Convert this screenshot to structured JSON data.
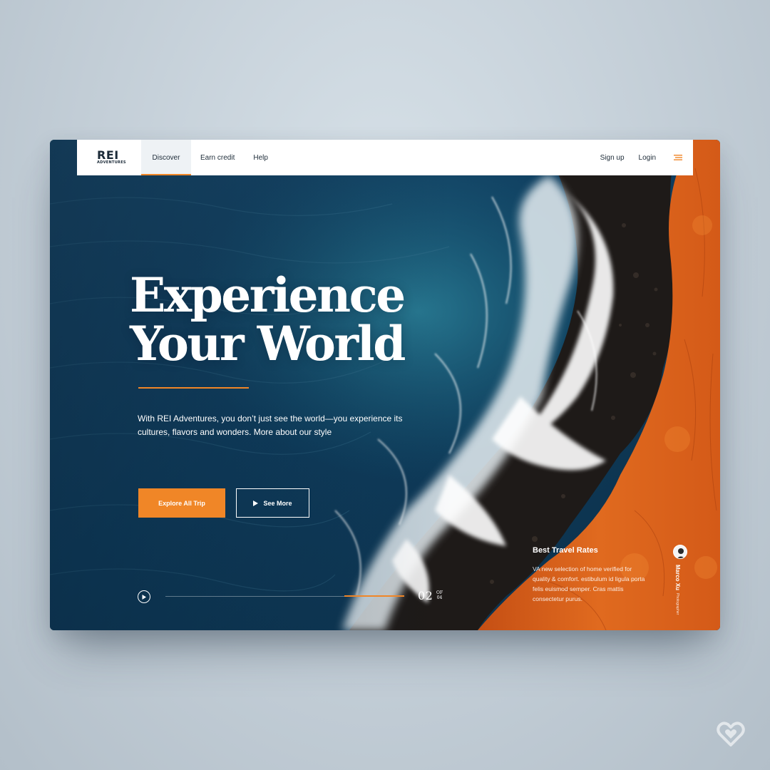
{
  "brand": {
    "name": "REI",
    "sub": "ADVENTURES"
  },
  "nav": {
    "tabs": [
      {
        "label": "Discover",
        "active": true
      },
      {
        "label": "Earn credit",
        "active": false
      },
      {
        "label": "Help",
        "active": false
      }
    ],
    "signup": "Sign up",
    "login": "Login",
    "menu_icon": "menu-icon"
  },
  "hero": {
    "title_line1": "Experience",
    "title_line2": "Your World",
    "description": "With REI Adventures, you don’t just see the world—you experience its cultures, flavors and wonders. More about our style",
    "primary_button": "Explore All Trip",
    "secondary_button": "See More"
  },
  "slider": {
    "current": "02",
    "of_label": "OF",
    "total": "04",
    "progress": 0.25
  },
  "rates": {
    "title": "Best Travel Rates",
    "body": "VA new selection of home verified for quality & comfort. estibulum id ligula porta felis euismod semper. Cras mattis consectetur purus."
  },
  "author": {
    "name": "Marco Xu",
    "role": "Photographer"
  },
  "colors": {
    "accent": "#f08627",
    "ink": "#1b2a38",
    "sea": "#123f5e",
    "lava": "#d9621e"
  }
}
